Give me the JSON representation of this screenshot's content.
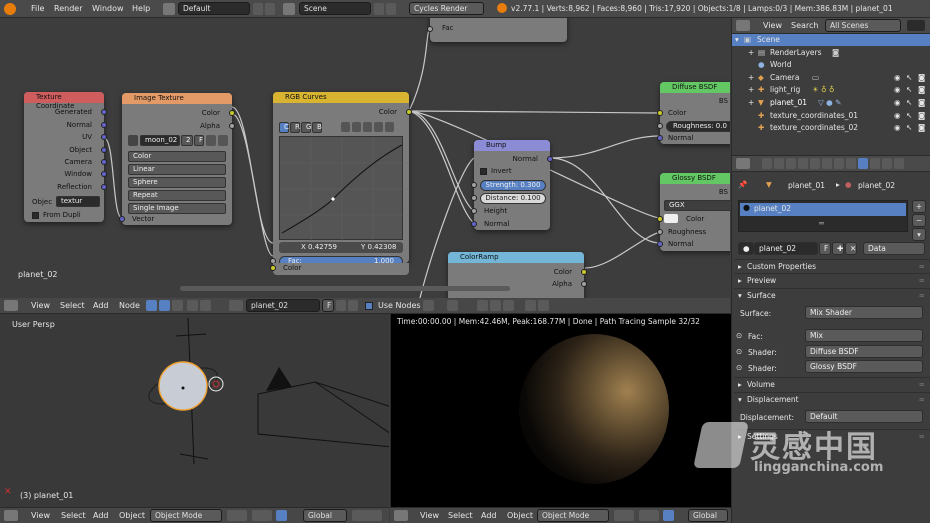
{
  "top_bar": {
    "menus": [
      "File",
      "Render",
      "Window",
      "Help"
    ],
    "layout": "Default",
    "scene": "Scene",
    "engine": "Cycles Render",
    "stats": "v2.77.1 | Verts:8,962 | Faces:8,960 | Tris:17,920 | Objects:1/8 | Lamps:0/3 | Mem:386.83M | planet_01"
  },
  "nodes": {
    "texcoord": {
      "title": "Texture Coordinate",
      "outputs": [
        "Generated",
        "Normal",
        "UV",
        "Object",
        "Camera",
        "Window",
        "Reflection"
      ],
      "object_label": "Objec",
      "object_value": "textur",
      "from_dupli": "From Dupli"
    },
    "image": {
      "title": "Image Texture",
      "out_color": "Color",
      "out_alpha": "Alpha",
      "image_name": "moon_02",
      "users": "2",
      "fake": "F",
      "color": "Color",
      "interp": "Linear",
      "proj": "Sphere",
      "ext": "Repeat",
      "src": "Single Image",
      "in_vector": "Vector"
    },
    "curves": {
      "title": "RGB Curves",
      "out_color": "Color",
      "tabs": [
        "C",
        "R",
        "G",
        "B"
      ],
      "x_readout": "X 0.42759",
      "y_readout": "Y 0.42308",
      "fac_label": "Fac:",
      "fac_value": "1.000",
      "in_color": "Color"
    },
    "bump": {
      "title": "Bump",
      "out_normal": "Normal",
      "invert": "Invert",
      "strength_label": "Strength:",
      "strength_value": "0.300",
      "distance_label": "Distance:",
      "distance_value": "0.100",
      "in_height": "Height",
      "in_normal": "Normal"
    },
    "diffuse": {
      "title": "Diffuse BSDF",
      "bsdf": "BS",
      "color": "Color",
      "roughness_label": "Roughness:",
      "roughness_value": "0.0",
      "normal": "Normal"
    },
    "glossy": {
      "title": "Glossy BSDF",
      "bsdf": "BS",
      "dist": "GGX",
      "color": "Color",
      "roughness": "Roughness",
      "normal": "Normal"
    },
    "colorramp": {
      "title": "ColorRamp",
      "color": "Color",
      "alpha": "Alpha"
    },
    "top_fac": "Fac",
    "material_label": "planet_02"
  },
  "node_header": {
    "menus": [
      "View",
      "Select",
      "Add",
      "Node"
    ],
    "material": "planet_02",
    "fake": "F",
    "use_nodes": "Use Nodes"
  },
  "outliner": {
    "menus": [
      "View",
      "Search"
    ],
    "filter": "All Scenes",
    "rows": [
      {
        "name": "Scene",
        "indent": 0,
        "selected": true
      },
      {
        "name": "RenderLayers",
        "indent": 1
      },
      {
        "name": "World",
        "indent": 1
      },
      {
        "name": "Camera",
        "indent": 1
      },
      {
        "name": "light_rig",
        "indent": 1
      },
      {
        "name": "planet_01",
        "indent": 1,
        "active": true
      },
      {
        "name": "texture_coordinates_01",
        "indent": 1
      },
      {
        "name": "texture_coordinates_02",
        "indent": 1
      }
    ]
  },
  "properties": {
    "breadcrumb_obj": "planet_01",
    "breadcrumb_mat": "planet_02",
    "slot": "planet_02",
    "material": "planet_02",
    "fake": "F",
    "data": "Data",
    "sections": [
      "Custom Properties",
      "Preview",
      "Surface"
    ],
    "surface_label": "Surface:",
    "surface_value": "Mix Shader",
    "fac_label": "Fac:",
    "fac_value": "Mix",
    "shader1_label": "Shader:",
    "shader1_value": "Diffuse BSDF",
    "shader2_label": "Shader:",
    "shader2_value": "Glossy BSDF",
    "volume": "Volume",
    "displacement_section": "Displacement",
    "displacement_label": "Displacement:",
    "displacement_value": "Default",
    "settings": "Settings"
  },
  "viewport_left": {
    "label": "User Persp",
    "object": "(3) planet_01",
    "menus": [
      "View",
      "Select",
      "Add",
      "Object"
    ],
    "mode": "Object Mode",
    "orientation": "Global"
  },
  "viewport_right": {
    "status": "Time:00:00.00 | Mem:42.46M, Peak:168.77M | Done | Path Tracing Sample 32/32",
    "menus": [
      "View",
      "Select",
      "Add",
      "Object"
    ],
    "mode": "Object Mode",
    "orientation": "Global"
  },
  "watermark": {
    "cn": "灵感中国",
    "url": "lingganchina.com"
  }
}
